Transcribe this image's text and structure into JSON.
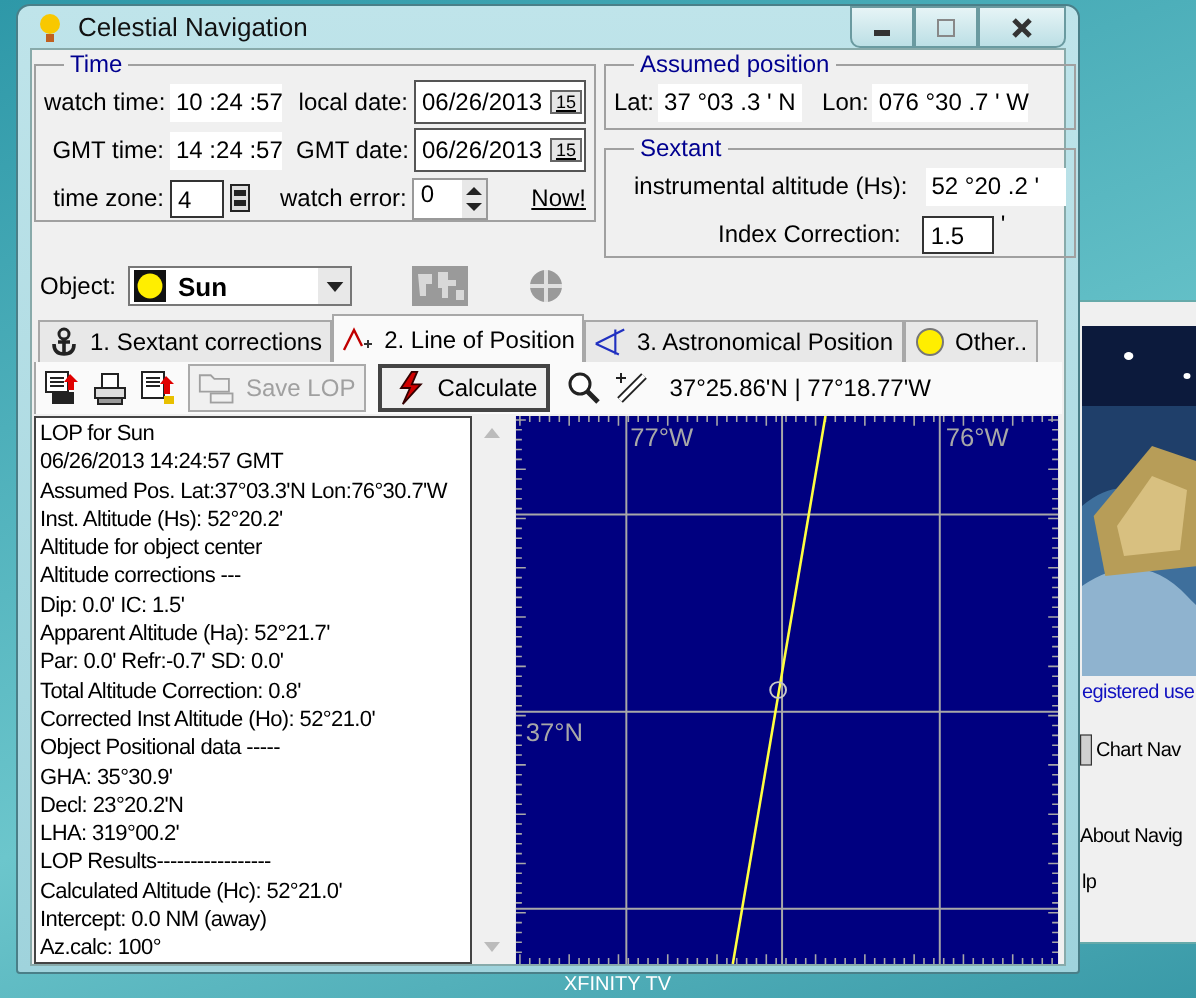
{
  "window": {
    "title": "Celestial Navigation"
  },
  "time": {
    "title": "Time",
    "watch_time_label": "watch time:",
    "watch_time": "10 :24 :57",
    "local_date_label": "local date:",
    "local_date": "06/26/2013",
    "local_date_button": "15",
    "gmt_time_label": "GMT time:",
    "gmt_time": "14 :24 :57",
    "gmt_date_label": "GMT date:",
    "gmt_date": "06/26/2013",
    "gmt_date_button": "15",
    "time_zone_label": "time zone:",
    "time_zone": "4",
    "watch_error_label": "watch error:",
    "watch_error": "0",
    "now_button": "Now!"
  },
  "assumed_position": {
    "title": "Assumed position",
    "lat_label": "Lat:",
    "lat": "37  °03 .3 ' N",
    "lon_label": "Lon:",
    "lon": "076 °30 .7 ' W"
  },
  "sextant": {
    "title": "Sextant",
    "hs_label": "instrumental altitude (Hs):",
    "hs": "52  °20 .2 '",
    "ic_label": "Index Correction:",
    "ic": "1.5",
    "ic_unit": "'"
  },
  "object": {
    "label": "Object:",
    "value": "Sun"
  },
  "tabs": [
    {
      "label": "1. Sextant corrections",
      "kind": "anchor",
      "selected": false
    },
    {
      "label": "2. Line of Position",
      "kind": "line",
      "selected": true
    },
    {
      "label": "3. Astronomical Position",
      "kind": "triangle",
      "selected": false
    },
    {
      "label": "Other..",
      "kind": "sun",
      "selected": false
    }
  ],
  "toolbar": {
    "save_lop": "Save LOP",
    "save_lop_disabled": true,
    "calculate": "Calculate",
    "coordinates": "37°25.86'N | 77°18.77'W"
  },
  "results": [
    "LOP for Sun",
    "06/26/2013 14:24:57 GMT",
    "Assumed Pos. Lat:37°03.3'N  Lon:76°30.7'W",
    "Inst. Altitude (Hs): 52°20.2'",
    "Altitude for object center",
    "Altitude corrections ---",
    "Dip: 0.0' IC: 1.5'",
    "Apparent Altitude (Ha): 52°21.7'",
    "Par: 0.0' Refr:-0.7' SD: 0.0'",
    "Total Altitude Correction: 0.8'",
    "Corrected Inst Altitude (Ho): 52°21.0'",
    "Object Positional data -----",
    "GHA: 35°30.9'",
    "Decl: 23°20.2'N",
    "LHA: 319°00.2'",
    "LOP Results-----------------",
    "Calculated Altitude (Hc): 52°21.0'",
    "Intercept:  0.0 NM (away)",
    "Az.calc:  100°"
  ],
  "map": {
    "lon_labels": [
      "77°W",
      "76°W"
    ],
    "lat_labels": [
      "37°N"
    ]
  },
  "background_window": {
    "link": "egistered use",
    "buttons": [
      "Chart Nav",
      "About Navig",
      "lp"
    ]
  },
  "desktop_icons": [
    "XFINITY TV"
  ]
}
